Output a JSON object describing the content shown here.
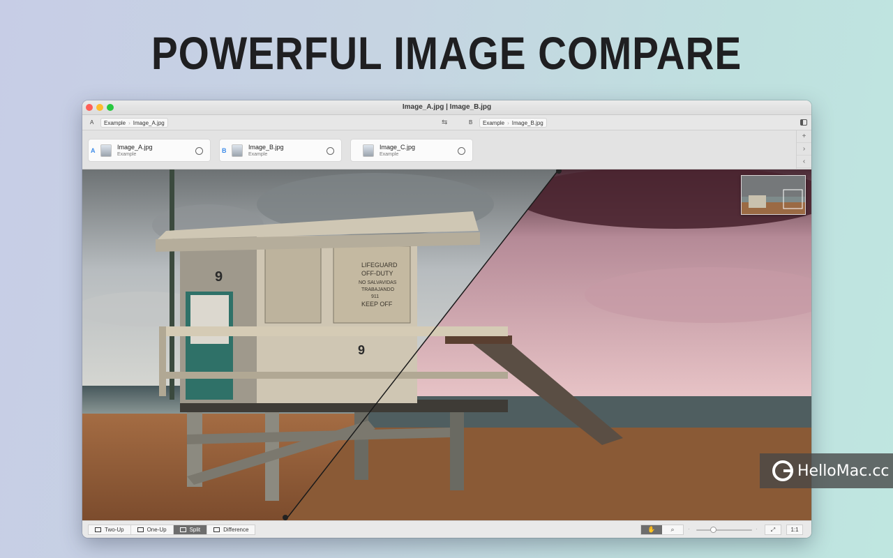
{
  "headline": "POWERFUL IMAGE COMPARE",
  "window": {
    "title": "Image_A.jpg | Image_B.jpg"
  },
  "pathbar": {
    "a_label": "A",
    "a_folder": "Example",
    "a_file": "Image_A.jpg",
    "b_label": "B",
    "b_folder": "Example",
    "b_file": "Image_B.jpg",
    "swap_icon": "⇆"
  },
  "images": [
    {
      "slot": "A",
      "name": "Image_A.jpg",
      "folder": "Example"
    },
    {
      "slot": "B",
      "name": "Image_B.jpg",
      "folder": "Example"
    },
    {
      "slot": "",
      "name": "Image_C.jpg",
      "folder": "Example"
    }
  ],
  "side_buttons": {
    "add": "+",
    "next": "›",
    "prev": "‹"
  },
  "viewer": {
    "mode": "split",
    "split_overlay_color": "#c4657a",
    "scene": {
      "tower_number": "9",
      "sign_lines": [
        "LIFEGUARD",
        "OFF-DUTY",
        "NO SALVAVIDAS",
        "TRABAJANDO",
        "911",
        "KEEP OFF"
      ]
    }
  },
  "compare_modes": [
    {
      "label": "Two-Up",
      "active": false
    },
    {
      "label": "One-Up",
      "active": false
    },
    {
      "label": "Split",
      "active": true
    },
    {
      "label": "Difference",
      "active": false
    }
  ],
  "tools": {
    "hand_icon": "✋",
    "zoom_icon": "⌕"
  },
  "zoom": {
    "level_fraction": 0.3,
    "fit_icon": "⤢",
    "actual_size_label": "1:1"
  },
  "watermark": {
    "text": "HelloMac.cc"
  }
}
